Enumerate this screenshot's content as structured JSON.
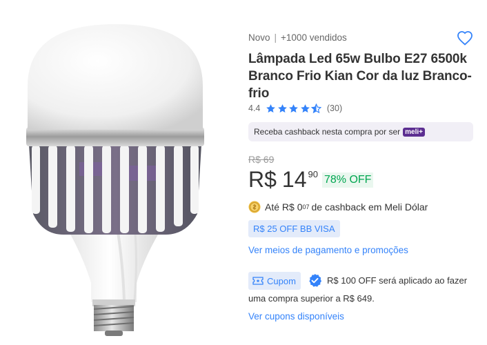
{
  "product": {
    "condition": "Novo",
    "separator": "|",
    "sold": "+1000 vendidos",
    "title": "Lâmpada Led 65w Bulbo E27 6500k Branco Frio Kian Cor da luz Branco-frio",
    "image_alt": "Lâmpada Led 65w Bulbo E27"
  },
  "rating": {
    "score": "4.4",
    "value": 4.4,
    "max": 5,
    "count": "(30)",
    "star_color": "#3483fa"
  },
  "cashback_banner": {
    "text": "Receba cashback nesta compra por ser",
    "badge": "meli+"
  },
  "price": {
    "old": "R$ 69",
    "currency": "R$",
    "integer": "14",
    "cents": "90",
    "discount": "78% OFF"
  },
  "meli_cash": {
    "prefix": "Até R$ 0",
    "cents": "07",
    "suffix": "de cashback em Meli Dólar"
  },
  "promo_badge": "R$ 25 OFF BB VISA",
  "payment_link": "Ver meios de pagamento e promoções",
  "coupon": {
    "chip_label": "Cupom",
    "line1": "R$ 100 OFF será aplicado ao fazer",
    "line2": "uma compra superior a R$ 649.",
    "link": "Ver cupons disponíveis"
  },
  "colors": {
    "accent": "#3483fa",
    "discount": "#00a650",
    "meli_purple": "#5c2e91"
  },
  "icons": {
    "favorite": "heart-icon",
    "rating": "star-icon",
    "coin": "coin-icon",
    "coupon": "ticket-icon",
    "check": "check-badge-icon"
  }
}
